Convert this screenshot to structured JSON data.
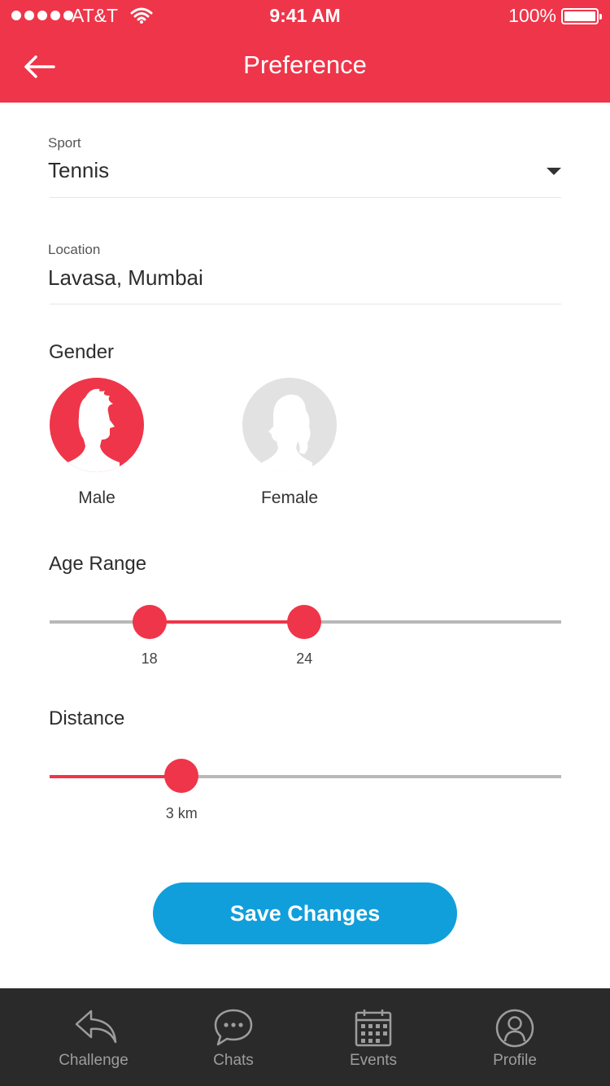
{
  "status_bar": {
    "carrier": "AT&T",
    "time": "9:41 AM",
    "battery": "100%"
  },
  "header": {
    "title": "Preference",
    "back_icon": "arrow-left-icon"
  },
  "form": {
    "sport": {
      "label": "Sport",
      "value": "Tennis"
    },
    "location": {
      "label": "Location",
      "value": "Lavasa, Mumbai"
    },
    "gender": {
      "title": "Gender",
      "options": [
        {
          "label": "Male",
          "selected": true,
          "icon": "male-silhouette-icon"
        },
        {
          "label": "Female",
          "selected": false,
          "icon": "female-silhouette-icon"
        }
      ]
    },
    "age_range": {
      "title": "Age Range",
      "min_label": "18",
      "max_label": "24",
      "min_fraction": 0.195,
      "max_fraction": 0.498
    },
    "distance": {
      "title": "Distance",
      "value_label": "3 km",
      "fraction": 0.258
    }
  },
  "actions": {
    "save_label": "Save Changes"
  },
  "tabbar": {
    "tabs": [
      {
        "label": "Challenge",
        "icon": "reply-arrow-icon"
      },
      {
        "label": "Chats",
        "icon": "chat-bubble-icon"
      },
      {
        "label": "Events",
        "icon": "calendar-icon"
      },
      {
        "label": "Profile",
        "icon": "user-icon"
      }
    ]
  },
  "colors": {
    "accent": "#ef3549",
    "button": "#109fdb",
    "tabbar": "#2a2a2a",
    "tab_label": "#9d9d9d"
  }
}
